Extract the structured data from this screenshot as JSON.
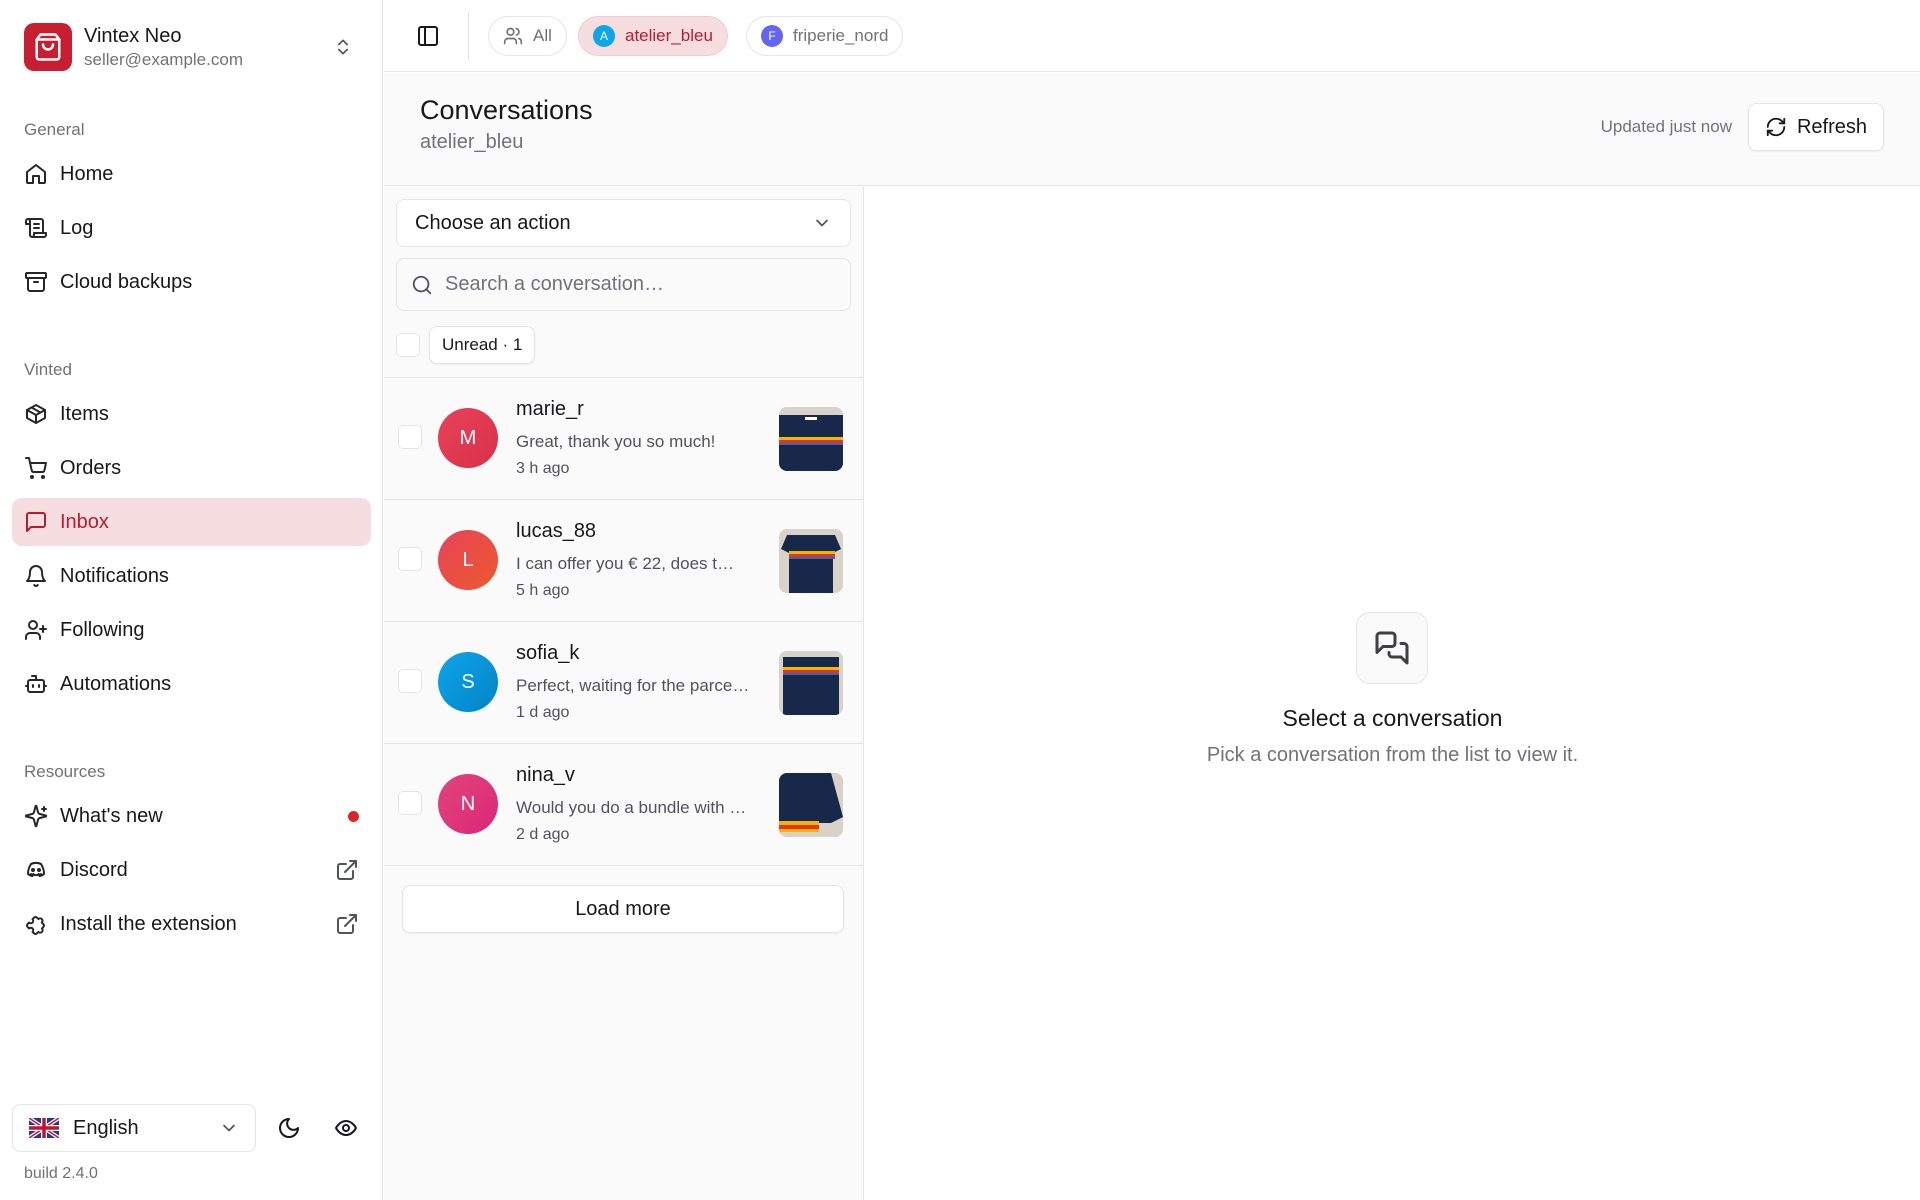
{
  "account": {
    "name": "Vintex Neo",
    "email": "seller@example.com"
  },
  "sidebar": {
    "sections": [
      {
        "label": "General",
        "items": [
          {
            "label": "Home",
            "icon": "home-icon"
          },
          {
            "label": "Log",
            "icon": "log-icon"
          },
          {
            "label": "Cloud backups",
            "icon": "archive-icon"
          }
        ]
      },
      {
        "label": "Vinted",
        "items": [
          {
            "label": "Items",
            "icon": "package-icon"
          },
          {
            "label": "Orders",
            "icon": "cart-icon"
          },
          {
            "label": "Inbox",
            "icon": "message-icon",
            "active": true
          },
          {
            "label": "Notifications",
            "icon": "bell-icon"
          },
          {
            "label": "Following",
            "icon": "user-plus-icon"
          },
          {
            "label": "Automations",
            "icon": "bot-icon"
          }
        ]
      },
      {
        "label": "Resources",
        "items": [
          {
            "label": "What's new",
            "icon": "sparkles-icon",
            "badge": "red-dot"
          },
          {
            "label": "Discord",
            "icon": "discord-icon",
            "external": true
          },
          {
            "label": "Install the extension",
            "icon": "puzzle-icon",
            "external": true
          }
        ]
      }
    ],
    "language": "English",
    "build": "build 2.4.0"
  },
  "topbar": {
    "chips": [
      {
        "label": "All",
        "icon": "users-icon",
        "active": false
      },
      {
        "label": "atelier_bleu",
        "avatar": "A",
        "avatar_color": "#0ea5e9",
        "active": true
      },
      {
        "label": "friperie_nord",
        "avatar": "F",
        "avatar_color": "#6366f1",
        "active": false
      }
    ]
  },
  "header": {
    "title": "Conversations",
    "subtitle": "atelier_bleu",
    "updated": "Updated just now",
    "refresh_label": "Refresh"
  },
  "list": {
    "action_placeholder": "Choose an action",
    "search_placeholder": "Search a conversation…",
    "unread_filter": "Unread · 1",
    "load_more": "Load more",
    "conversations": [
      {
        "name": "marie_r",
        "initial": "M",
        "preview": "Great, thank you so much!",
        "time": "3 h ago",
        "avatar_color": "#e8425a"
      },
      {
        "name": "lucas_88",
        "initial": "L",
        "preview": "I can offer you  € 22, does t…",
        "time": "5 h ago",
        "avatar_color": "#ea4a3c"
      },
      {
        "name": "sofia_k",
        "initial": "S",
        "preview": "Perfect, waiting for the parce…",
        "time": "1 d ago",
        "avatar_color": "#0ea5e9"
      },
      {
        "name": "nina_v",
        "initial": "N",
        "preview": "Would you do a bundle with …",
        "time": "2 d ago",
        "avatar_color": "#e2457a"
      }
    ]
  },
  "empty_state": {
    "title": "Select a conversation",
    "subtitle": "Pick a conversation from the list to view it."
  },
  "colors": {
    "brand": "#c81e32",
    "active_bg": "#f5dde0",
    "active_text": "#b91c2e"
  }
}
